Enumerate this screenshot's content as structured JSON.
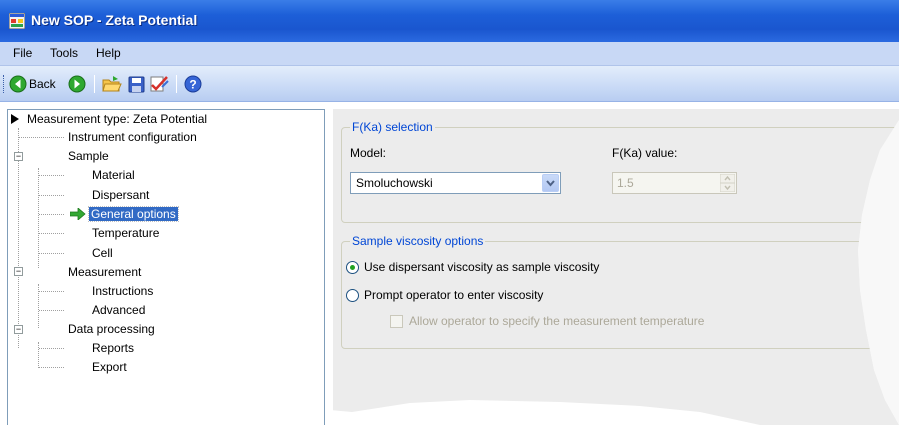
{
  "window": {
    "title": "New SOP - Zeta Potential"
  },
  "menubar": {
    "items": [
      "File",
      "Tools",
      "Help"
    ]
  },
  "toolbar": {
    "back_label": "Back"
  },
  "tree": {
    "root": "Measurement type: Zeta Potential",
    "items": [
      {
        "label": "Instrument configuration"
      },
      {
        "label": "Sample"
      },
      {
        "label": "Material"
      },
      {
        "label": "Dispersant"
      },
      {
        "label": "General options"
      },
      {
        "label": "Temperature"
      },
      {
        "label": "Cell"
      },
      {
        "label": "Measurement"
      },
      {
        "label": "Instructions"
      },
      {
        "label": "Advanced"
      },
      {
        "label": "Data processing"
      },
      {
        "label": "Reports"
      },
      {
        "label": "Export"
      }
    ]
  },
  "fka": {
    "group_title": "F(Ka) selection",
    "model_label": "Model:",
    "model_value": "Smoluchowski",
    "value_label": "F(Ka) value:",
    "value": "1.5"
  },
  "viscosity": {
    "group_title": "Sample viscosity options",
    "option1": "Use dispersant viscosity as sample viscosity",
    "option2": "Prompt operator to enter viscosity",
    "checkbox": "Allow operator to specify the measurement temperature"
  },
  "colors": {
    "title_bar": "#1d5fd8",
    "selection": "#316ac5",
    "group_title": "#0046d5"
  }
}
